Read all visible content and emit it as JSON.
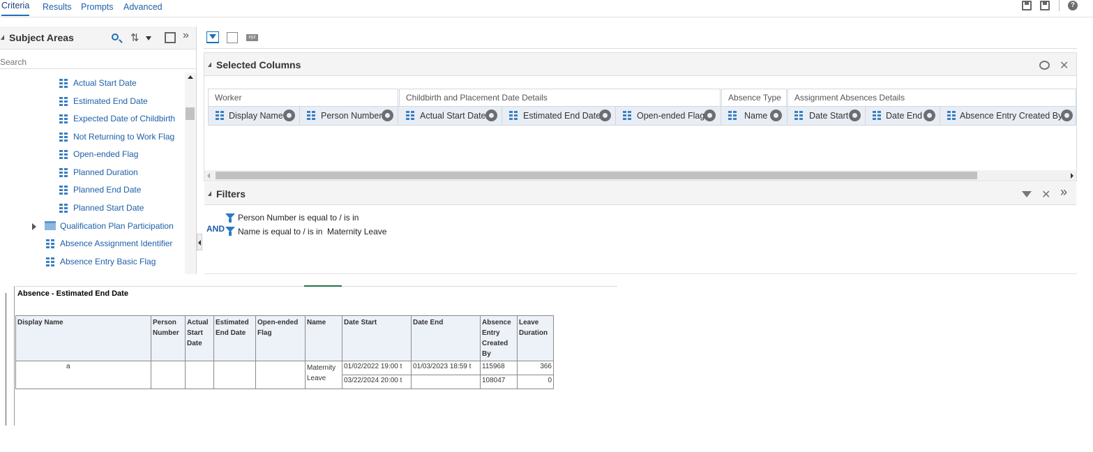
{
  "tabs": [
    {
      "label": "Criteria",
      "active": true
    },
    {
      "label": "Results",
      "active": false
    },
    {
      "label": "Prompts",
      "active": false
    },
    {
      "label": "Advanced",
      "active": false
    }
  ],
  "subject_areas": {
    "title": "Subject Areas",
    "search_placeholder": "Search",
    "items": [
      {
        "label": "Actual Start Date",
        "icon": "column-icon"
      },
      {
        "label": "Estimated End Date",
        "icon": "column-icon"
      },
      {
        "label": "Expected Date of Childbirth",
        "icon": "column-icon"
      },
      {
        "label": "Not Returning to Work Flag",
        "icon": "column-icon"
      },
      {
        "label": "Open-ended Flag",
        "icon": "column-icon"
      },
      {
        "label": "Planned Duration",
        "icon": "column-icon"
      },
      {
        "label": "Planned End Date",
        "icon": "column-icon"
      },
      {
        "label": "Planned Start Date",
        "icon": "column-icon"
      },
      {
        "label": "Qualification Plan Participation",
        "icon": "folder-icon"
      },
      {
        "label": "Absence Assignment Identifier",
        "icon": "column-icon"
      },
      {
        "label": "Absence Entry Basic Flag",
        "icon": "column-icon"
      }
    ]
  },
  "selected_columns": {
    "title": "Selected Columns",
    "groups": [
      {
        "label": "Worker"
      },
      {
        "label": "Childbirth and Placement Date Details"
      },
      {
        "label": "Absence Type"
      },
      {
        "label": "Assignment Absences Details"
      }
    ],
    "columns": [
      "Display Name",
      "Person Number",
      "Actual Start Date",
      "Estimated End Date",
      "Open-ended Flag",
      "Name",
      "Date Start",
      "Date End",
      "Absence Entry Created By"
    ]
  },
  "filters": {
    "title": "Filters",
    "operator": "AND",
    "items": [
      {
        "text": "Person Number is equal to / is in"
      },
      {
        "text": "Name is equal to / is in  Maternity Leave"
      }
    ]
  },
  "report": {
    "title": "Absence - Estimated End Date",
    "headers": [
      "Display Name",
      "Person Number",
      "Actual Start Date",
      "Estimated End Date",
      "Open-ended Flag",
      "Name",
      "Date Start",
      "Date End",
      "Absence Entry Created By",
      "Leave Duration"
    ],
    "display_name_fragment": "a",
    "name_value": "Maternity Leave",
    "rows": [
      {
        "date_start": "01/02/2022 19:00 t",
        "date_end": "01/03/2023 18:59 t",
        "created_by": "115968",
        "duration": "366"
      },
      {
        "date_start": "03/22/2024 20:00 t",
        "date_end": "",
        "created_by": "108047",
        "duration": "0"
      }
    ]
  },
  "colors": {
    "accent": "#1d6fb8",
    "link": "#1d5fa8",
    "header_bg": "#e9eef5"
  }
}
